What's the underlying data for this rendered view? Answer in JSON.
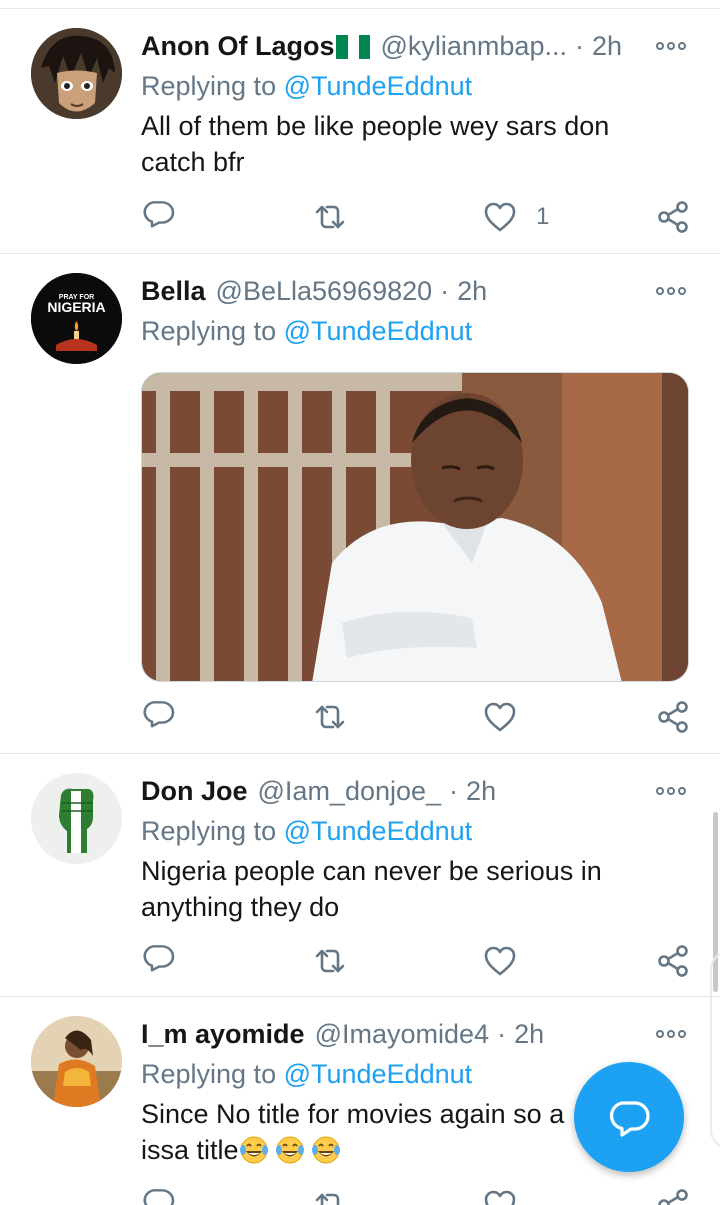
{
  "tweets": [
    {
      "name": "Anon Of Lagos",
      "handle": "@kylianmbap...",
      "time": "2h",
      "replying_prefix": "Replying to",
      "replying_to": "@TundeEddnut",
      "text": "All of them be like people wey sars don catch bfr",
      "like_count": "1",
      "avatar_icon": "anime-face-avatar",
      "name_flag": "nigeria-flag-emoji"
    },
    {
      "name": "Bella",
      "handle": "@BeLla56969820",
      "time": "2h",
      "replying_prefix": "Replying to",
      "replying_to": "@TundeEddnut",
      "avatar_text_top": "PRAY FOR",
      "avatar_text_main": "NIGERIA",
      "media_icon": "man-in-white-shirt-photo"
    },
    {
      "name": "Don Joe",
      "handle": "@Iam_donjoe_",
      "time": "2h",
      "replying_prefix": "Replying to",
      "replying_to": "@TundeEddnut",
      "text_line1": "Nigeria people can never be serious in",
      "text_line2": "anything they do",
      "avatar_icon": "raised-fist-nigeria-avatar"
    },
    {
      "name": "I_m ayomide",
      "handle": "@Imayomide4",
      "time": "2h",
      "replying_prefix": "Replying to",
      "replying_to": "@TundeEddnut",
      "text_line1": "Since No title for movies again so a",
      "text_line2": "issa title",
      "emoji_icon": "face-with-tears-of-joy-emoji",
      "avatar_icon": "person-photo-avatar"
    }
  ],
  "fab": {
    "icon": "compose-reply-icon"
  },
  "colors": {
    "accent": "#1da1f2",
    "secondary_text": "#657786",
    "primary_text": "#14171a",
    "divider": "#e1e8ed"
  }
}
